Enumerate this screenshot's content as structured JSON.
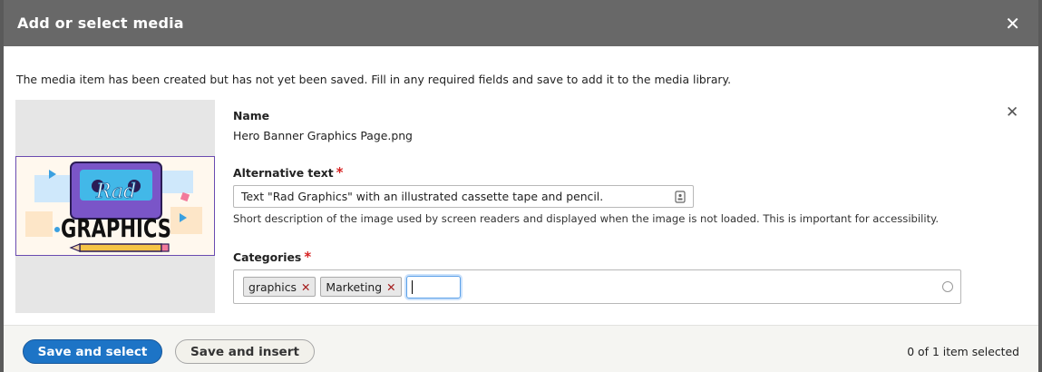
{
  "dialog": {
    "title": "Add or select media",
    "close_icon": "close-icon"
  },
  "notice": "The media item has been created but has not yet been saved. Fill in any required fields and save to add it to the media library.",
  "media": {
    "name_label": "Name",
    "name_value": "Hero Banner Graphics Page.png",
    "alt_label": "Alternative text",
    "required_mark": "*",
    "alt_value": "Text \"Rad Graphics\" with an illustrated cassette tape and pencil.",
    "alt_description": "Short description of the image used by screen readers and displayed when the image is not loaded. This is important for accessibility.",
    "categories_label": "Categories",
    "tags": [
      {
        "label": "graphics"
      },
      {
        "label": "Marketing"
      }
    ],
    "tag_remove_glyph": "✕",
    "remove_glyph": "✕",
    "thumbnail_text": {
      "line1": "Rad",
      "line2": "GRAPHICS"
    }
  },
  "footer": {
    "save_select": "Save and select",
    "save_insert": "Save and insert",
    "selected_count": "0 of 1 item selected"
  },
  "colors": {
    "titlebar": "#686868",
    "primary_button": "#1d74c6",
    "required": "#d72222"
  }
}
